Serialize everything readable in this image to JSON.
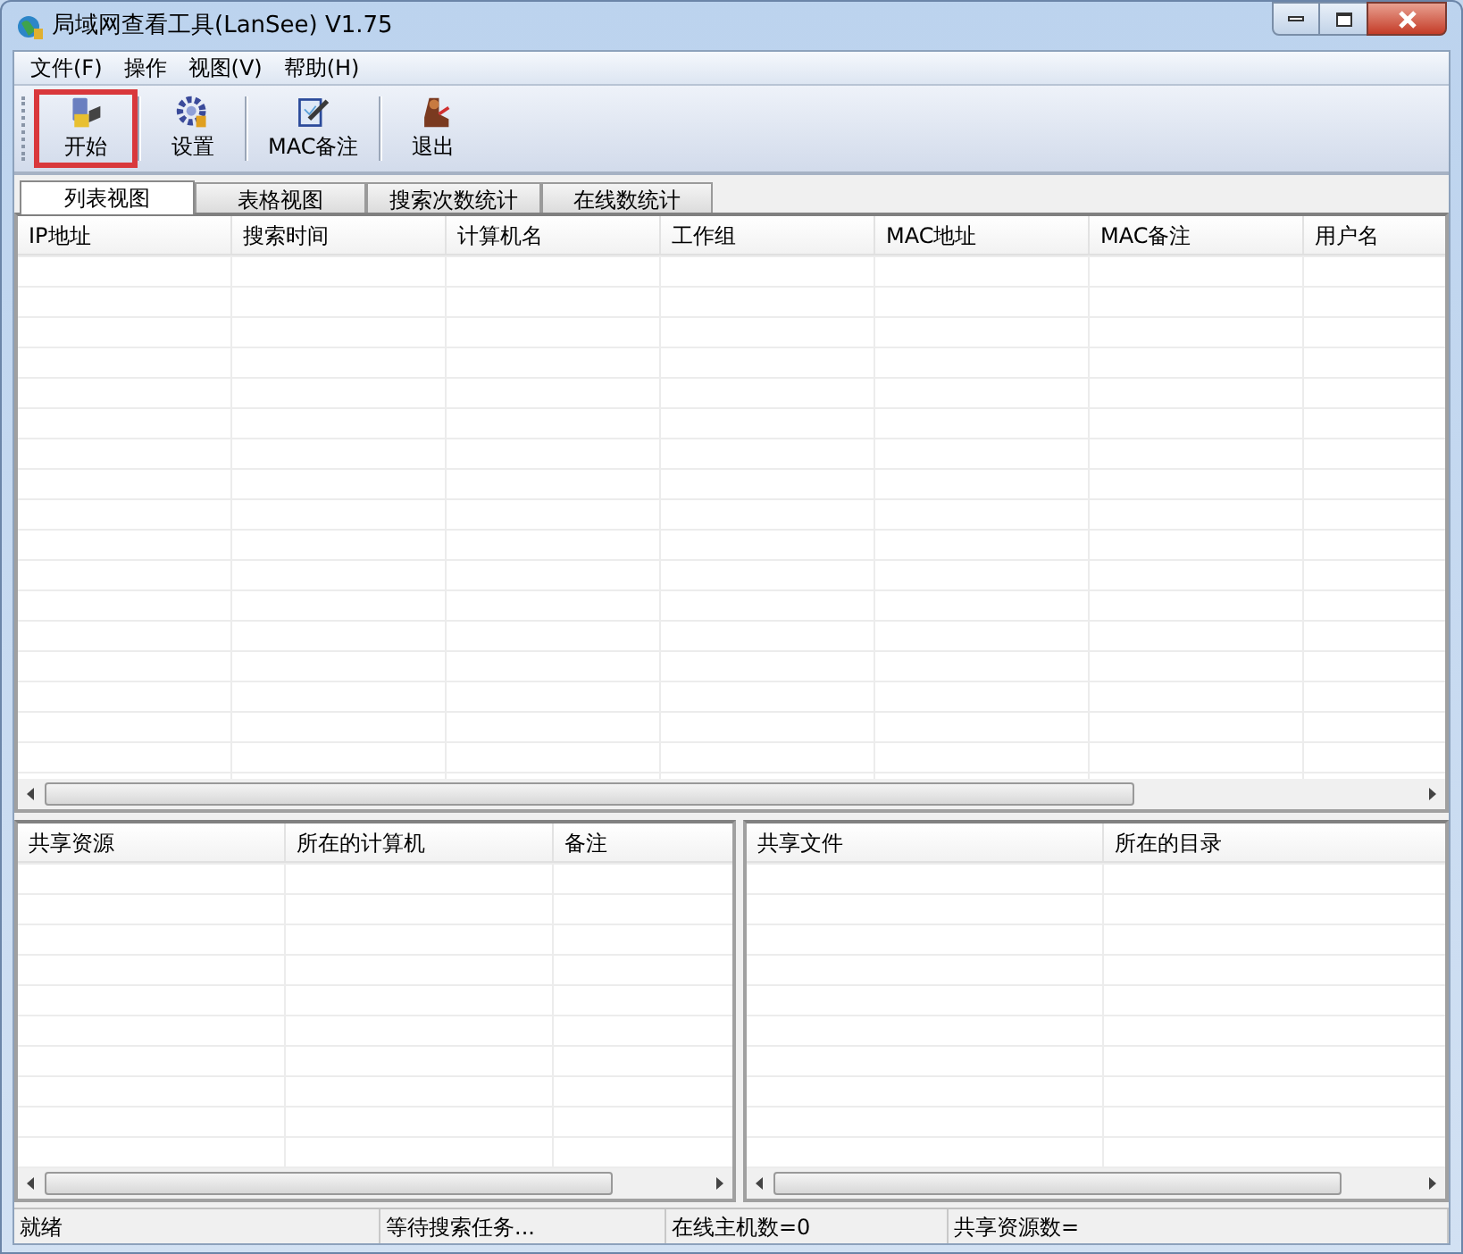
{
  "window": {
    "title": "局域网查看工具(LanSee) V1.75"
  },
  "menu": [
    "文件(F)",
    "操作",
    "视图(V)",
    "帮助(H)"
  ],
  "toolbar": [
    {
      "kind": "start",
      "label": "开始",
      "marked": true
    },
    {
      "kind": "settings",
      "label": "设置",
      "marked": false
    },
    {
      "kind": "mac",
      "label": "MAC备注",
      "marked": false
    },
    {
      "kind": "exit",
      "label": "退出",
      "marked": false
    }
  ],
  "tabs": [
    {
      "label": "列表视图",
      "selected": true
    },
    {
      "label": "表格视图",
      "selected": false
    },
    {
      "label": "搜索次数统计",
      "selected": false
    },
    {
      "label": "在线数统计",
      "selected": false
    }
  ],
  "host_table": {
    "columns": [
      "IP地址",
      "搜索时间",
      "计算机名",
      "工作组",
      "MAC地址",
      "MAC备注",
      "用户名"
    ]
  },
  "share_table": {
    "columns": [
      "共享资源",
      "所在的计算机",
      "备注"
    ]
  },
  "file_table": {
    "columns": [
      "共享文件",
      "所在的目录"
    ]
  },
  "status_bar": [
    "就绪",
    "等待搜索任务...",
    "在线主机数=0",
    "共享资源数="
  ]
}
